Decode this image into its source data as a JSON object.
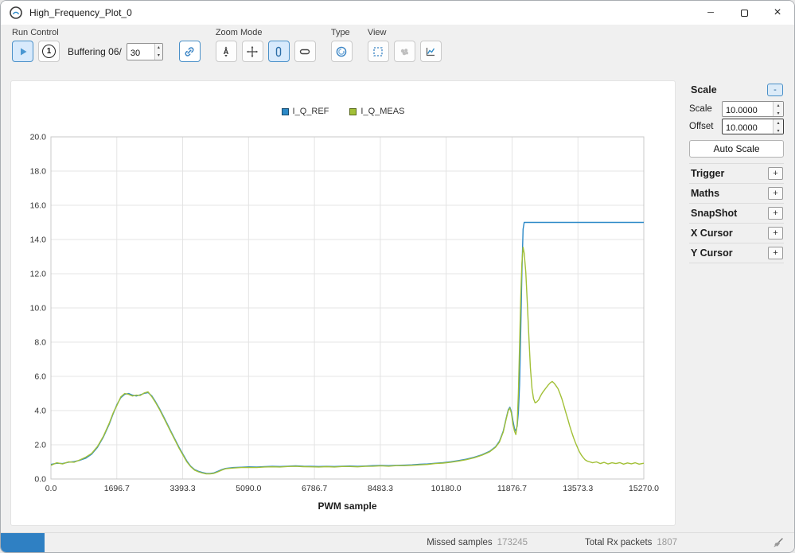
{
  "window": {
    "title": "High_Frequency_Plot_0"
  },
  "icons": {
    "minimize": "─",
    "close": "×",
    "spin_up": "▴",
    "spin_down": "▾"
  },
  "toolbar": {
    "groups": {
      "run_control": "Run Control",
      "zoom_mode": "Zoom Mode",
      "type": "Type",
      "view": "View"
    },
    "one_button_label": "1",
    "buffering_label": "Buffering 06/",
    "buffer_count": "30"
  },
  "sidebar": {
    "scale_panel": {
      "title": "Scale",
      "collapse_label": "-",
      "rows": [
        {
          "label": "Scale",
          "value": "10.0000"
        },
        {
          "label": "Offset",
          "value": "10.0000"
        }
      ],
      "auto_scale": "Auto Scale"
    },
    "collapsed_sections": [
      {
        "label": "Trigger",
        "expand": "+"
      },
      {
        "label": "Maths",
        "expand": "+"
      },
      {
        "label": "SnapShot",
        "expand": "+"
      },
      {
        "label": "X Cursor",
        "expand": "+"
      },
      {
        "label": "Y Cursor",
        "expand": "+"
      }
    ]
  },
  "statusbar": {
    "missed_samples_label": "Missed samples",
    "missed_samples_value": "173245",
    "total_rx_label": "Total Rx packets",
    "total_rx_value": "1807"
  },
  "chart_data": {
    "type": "line",
    "title": "",
    "xlabel": "PWM sample",
    "ylabel": "",
    "xlim": [
      0,
      15270
    ],
    "ylim": [
      0,
      20
    ],
    "xticks": [
      0,
      1696.7,
      3393.3,
      5090,
      6786.7,
      8483.3,
      10180,
      11876.7,
      13573.3,
      15270
    ],
    "yticks": [
      0,
      2,
      4,
      6,
      8,
      10,
      12,
      14,
      16,
      18,
      20
    ],
    "grid": true,
    "legend_position": "top-center",
    "series": [
      {
        "name": "I_Q_REF",
        "color": "#2c89c7",
        "points": [
          [
            0,
            0.85
          ],
          [
            150,
            0.92
          ],
          [
            300,
            0.9
          ],
          [
            450,
            0.98
          ],
          [
            600,
            1.02
          ],
          [
            750,
            1.1
          ],
          [
            900,
            1.22
          ],
          [
            1050,
            1.45
          ],
          [
            1200,
            1.85
          ],
          [
            1350,
            2.45
          ],
          [
            1500,
            3.2
          ],
          [
            1600,
            3.8
          ],
          [
            1700,
            4.35
          ],
          [
            1800,
            4.75
          ],
          [
            1900,
            4.95
          ],
          [
            2000,
            5.0
          ],
          [
            2100,
            4.9
          ],
          [
            2200,
            4.85
          ],
          [
            2300,
            4.92
          ],
          [
            2400,
            5.0
          ],
          [
            2500,
            5.05
          ],
          [
            2600,
            4.85
          ],
          [
            2700,
            4.5
          ],
          [
            2800,
            4.1
          ],
          [
            2900,
            3.65
          ],
          [
            3000,
            3.2
          ],
          [
            3100,
            2.75
          ],
          [
            3200,
            2.3
          ],
          [
            3300,
            1.85
          ],
          [
            3400,
            1.45
          ],
          [
            3500,
            1.05
          ],
          [
            3600,
            0.75
          ],
          [
            3700,
            0.55
          ],
          [
            3800,
            0.45
          ],
          [
            3900,
            0.38
          ],
          [
            4000,
            0.33
          ],
          [
            4100,
            0.32
          ],
          [
            4200,
            0.36
          ],
          [
            4300,
            0.45
          ],
          [
            4400,
            0.55
          ],
          [
            4500,
            0.62
          ],
          [
            4700,
            0.67
          ],
          [
            4900,
            0.69
          ],
          [
            5100,
            0.71
          ],
          [
            5300,
            0.7
          ],
          [
            5500,
            0.72
          ],
          [
            5700,
            0.74
          ],
          [
            5900,
            0.73
          ],
          [
            6100,
            0.75
          ],
          [
            6300,
            0.77
          ],
          [
            6500,
            0.75
          ],
          [
            6700,
            0.74
          ],
          [
            6900,
            0.73
          ],
          [
            7100,
            0.74
          ],
          [
            7300,
            0.73
          ],
          [
            7500,
            0.75
          ],
          [
            7700,
            0.76
          ],
          [
            7900,
            0.74
          ],
          [
            8100,
            0.76
          ],
          [
            8300,
            0.78
          ],
          [
            8500,
            0.79
          ],
          [
            8700,
            0.78
          ],
          [
            8900,
            0.8
          ],
          [
            9100,
            0.81
          ],
          [
            9300,
            0.83
          ],
          [
            9500,
            0.86
          ],
          [
            9700,
            0.88
          ],
          [
            9900,
            0.92
          ],
          [
            10100,
            0.96
          ],
          [
            10300,
            1.01
          ],
          [
            10500,
            1.08
          ],
          [
            10700,
            1.16
          ],
          [
            10900,
            1.27
          ],
          [
            11100,
            1.42
          ],
          [
            11300,
            1.62
          ],
          [
            11450,
            1.88
          ],
          [
            11550,
            2.2
          ],
          [
            11650,
            2.8
          ],
          [
            11720,
            3.5
          ],
          [
            11780,
            4.05
          ],
          [
            11820,
            4.2
          ],
          [
            11860,
            3.95
          ],
          [
            11900,
            3.4
          ],
          [
            11940,
            2.95
          ],
          [
            11975,
            2.8
          ],
          [
            12010,
            3.1
          ],
          [
            12040,
            3.9
          ],
          [
            12070,
            5.5
          ],
          [
            12100,
            8.5
          ],
          [
            12130,
            12.0
          ],
          [
            12160,
            14.6
          ],
          [
            12190,
            15.0
          ],
          [
            12400,
            15.0
          ],
          [
            12800,
            15.0
          ],
          [
            13300,
            15.0
          ],
          [
            13800,
            15.0
          ],
          [
            14300,
            15.0
          ],
          [
            14800,
            15.0
          ],
          [
            15270,
            15.0
          ]
        ]
      },
      {
        "name": "I_Q_MEAS",
        "color": "#a2c037",
        "points": [
          [
            0,
            0.8
          ],
          [
            150,
            0.95
          ],
          [
            300,
            0.88
          ],
          [
            450,
            1.0
          ],
          [
            600,
            0.98
          ],
          [
            750,
            1.12
          ],
          [
            900,
            1.28
          ],
          [
            1050,
            1.5
          ],
          [
            1200,
            1.9
          ],
          [
            1350,
            2.5
          ],
          [
            1500,
            3.25
          ],
          [
            1600,
            3.85
          ],
          [
            1700,
            4.3
          ],
          [
            1800,
            4.8
          ],
          [
            1900,
            5.0
          ],
          [
            2000,
            4.95
          ],
          [
            2100,
            4.85
          ],
          [
            2200,
            4.9
          ],
          [
            2300,
            4.88
          ],
          [
            2400,
            5.03
          ],
          [
            2500,
            5.1
          ],
          [
            2600,
            4.8
          ],
          [
            2700,
            4.45
          ],
          [
            2800,
            4.05
          ],
          [
            2900,
            3.6
          ],
          [
            3000,
            3.15
          ],
          [
            3100,
            2.7
          ],
          [
            3200,
            2.25
          ],
          [
            3300,
            1.8
          ],
          [
            3400,
            1.4
          ],
          [
            3500,
            1.0
          ],
          [
            3600,
            0.72
          ],
          [
            3700,
            0.52
          ],
          [
            3800,
            0.42
          ],
          [
            3900,
            0.35
          ],
          [
            4000,
            0.3
          ],
          [
            4100,
            0.3
          ],
          [
            4200,
            0.33
          ],
          [
            4300,
            0.42
          ],
          [
            4400,
            0.52
          ],
          [
            4500,
            0.6
          ],
          [
            4700,
            0.64
          ],
          [
            4900,
            0.67
          ],
          [
            5100,
            0.68
          ],
          [
            5300,
            0.67
          ],
          [
            5500,
            0.7
          ],
          [
            5700,
            0.71
          ],
          [
            5900,
            0.7
          ],
          [
            6100,
            0.73
          ],
          [
            6300,
            0.74
          ],
          [
            6500,
            0.72
          ],
          [
            6700,
            0.71
          ],
          [
            6900,
            0.7
          ],
          [
            7100,
            0.72
          ],
          [
            7300,
            0.7
          ],
          [
            7500,
            0.73
          ],
          [
            7700,
            0.73
          ],
          [
            7900,
            0.71
          ],
          [
            8100,
            0.74
          ],
          [
            8300,
            0.75
          ],
          [
            8500,
            0.77
          ],
          [
            8700,
            0.75
          ],
          [
            8900,
            0.78
          ],
          [
            9100,
            0.78
          ],
          [
            9300,
            0.8
          ],
          [
            9500,
            0.83
          ],
          [
            9700,
            0.85
          ],
          [
            9900,
            0.9
          ],
          [
            10100,
            0.93
          ],
          [
            10300,
            0.98
          ],
          [
            10500,
            1.05
          ],
          [
            10700,
            1.13
          ],
          [
            10900,
            1.24
          ],
          [
            11100,
            1.39
          ],
          [
            11300,
            1.59
          ],
          [
            11450,
            1.85
          ],
          [
            11550,
            2.15
          ],
          [
            11650,
            2.75
          ],
          [
            11720,
            3.45
          ],
          [
            11780,
            4.0
          ],
          [
            11820,
            4.15
          ],
          [
            11860,
            3.85
          ],
          [
            11900,
            3.2
          ],
          [
            11940,
            2.8
          ],
          [
            11975,
            2.6
          ],
          [
            12010,
            3.2
          ],
          [
            12040,
            5.0
          ],
          [
            12070,
            7.8
          ],
          [
            12100,
            10.5
          ],
          [
            12130,
            12.6
          ],
          [
            12160,
            13.55
          ],
          [
            12190,
            13.2
          ],
          [
            12230,
            12.1
          ],
          [
            12270,
            10.3
          ],
          [
            12310,
            8.3
          ],
          [
            12350,
            6.5
          ],
          [
            12390,
            5.3
          ],
          [
            12430,
            4.7
          ],
          [
            12470,
            4.45
          ],
          [
            12510,
            4.5
          ],
          [
            12560,
            4.62
          ],
          [
            12610,
            4.85
          ],
          [
            12660,
            5.05
          ],
          [
            12710,
            5.2
          ],
          [
            12760,
            5.35
          ],
          [
            12810,
            5.5
          ],
          [
            12860,
            5.62
          ],
          [
            12910,
            5.7
          ],
          [
            12960,
            5.6
          ],
          [
            13010,
            5.45
          ],
          [
            13060,
            5.28
          ],
          [
            13110,
            5.0
          ],
          [
            13160,
            4.68
          ],
          [
            13210,
            4.3
          ],
          [
            13260,
            3.9
          ],
          [
            13310,
            3.52
          ],
          [
            13360,
            3.12
          ],
          [
            13410,
            2.75
          ],
          [
            13460,
            2.42
          ],
          [
            13510,
            2.12
          ],
          [
            13560,
            1.85
          ],
          [
            13610,
            1.6
          ],
          [
            13660,
            1.4
          ],
          [
            13710,
            1.25
          ],
          [
            13760,
            1.12
          ],
          [
            13810,
            1.05
          ],
          [
            13880,
            1.0
          ],
          [
            13950,
            0.95
          ],
          [
            14050,
            1.0
          ],
          [
            14150,
            0.9
          ],
          [
            14250,
            0.97
          ],
          [
            14350,
            0.88
          ],
          [
            14450,
            0.95
          ],
          [
            14550,
            0.9
          ],
          [
            14650,
            0.96
          ],
          [
            14750,
            0.87
          ],
          [
            14850,
            0.94
          ],
          [
            14950,
            0.89
          ],
          [
            15050,
            0.95
          ],
          [
            15150,
            0.87
          ],
          [
            15270,
            0.92
          ]
        ]
      }
    ]
  }
}
